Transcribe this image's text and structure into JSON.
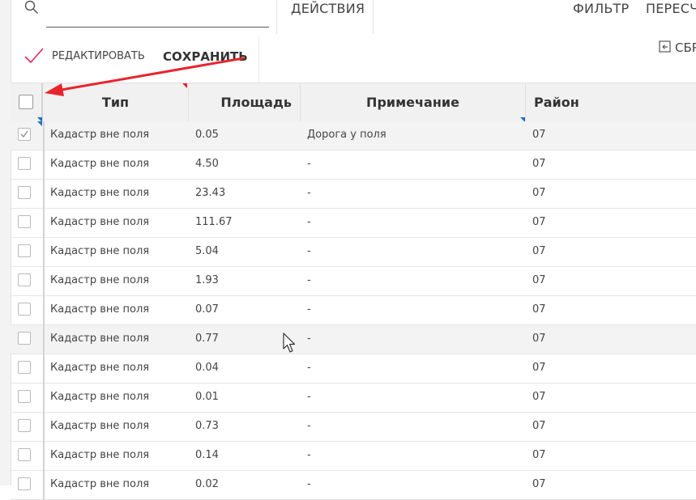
{
  "topbar": {
    "tabs": [
      {
        "label": "ДЕЙСТВИЯ"
      },
      {
        "label": "ФИЛЬТР"
      },
      {
        "label": "ПЕРЕСЧ"
      }
    ]
  },
  "toolbar": {
    "edit_label": "РЕДАКТИРОВАТЬ",
    "save_label": "СОХРАНИТЬ",
    "reset_label": "СБР"
  },
  "table": {
    "columns": [
      {
        "label": "Тип"
      },
      {
        "label": "Площадь"
      },
      {
        "label": "Примечание"
      },
      {
        "label": "Район"
      }
    ],
    "rows": [
      {
        "type": "Кадастр вне поля",
        "area": "0.05",
        "note": "Дорога у поля",
        "district": "07",
        "checked": true
      },
      {
        "type": "Кадастр вне поля",
        "area": "4.50",
        "note": "-",
        "district": "07",
        "checked": false
      },
      {
        "type": "Кадастр вне поля",
        "area": "23.43",
        "note": "-",
        "district": "07",
        "checked": false
      },
      {
        "type": "Кадастр вне поля",
        "area": "111.67",
        "note": "-",
        "district": "07",
        "checked": false
      },
      {
        "type": "Кадастр вне поля",
        "area": "5.04",
        "note": "-",
        "district": "07",
        "checked": false
      },
      {
        "type": "Кадастр вне поля",
        "area": "1.93",
        "note": "-",
        "district": "07",
        "checked": false
      },
      {
        "type": "Кадастр вне поля",
        "area": "0.07",
        "note": "-",
        "district": "07",
        "checked": false
      },
      {
        "type": "Кадастр вне поля",
        "area": "0.77",
        "note": "-",
        "district": "07",
        "checked": false
      },
      {
        "type": "Кадастр вне поля",
        "area": "0.04",
        "note": "-",
        "district": "07",
        "checked": false
      },
      {
        "type": "Кадастр вне поля",
        "area": "0.01",
        "note": "-",
        "district": "07",
        "checked": false
      },
      {
        "type": "Кадастр вне поля",
        "area": "0.73",
        "note": "-",
        "district": "07",
        "checked": false
      },
      {
        "type": "Кадастр вне поля",
        "area": "0.14",
        "note": "-",
        "district": "07",
        "checked": false
      },
      {
        "type": "Кадастр вне поля",
        "area": "0.02",
        "note": "-",
        "district": "07",
        "checked": false
      }
    ]
  },
  "colors": {
    "annotation_arrow": "#e8242e",
    "check_accent": "#e0245e",
    "sort_marker_red": "#e8242e",
    "sort_marker_blue": "#1e6fc4",
    "hover_row": "#f3f3f3"
  }
}
